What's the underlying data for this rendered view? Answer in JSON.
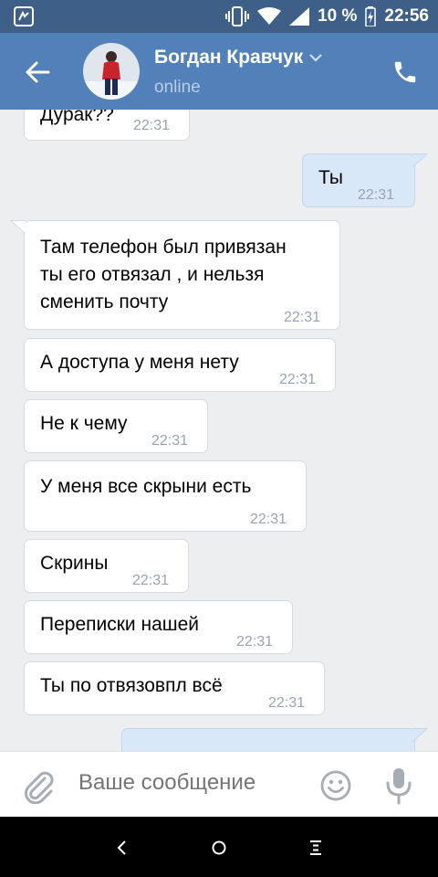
{
  "status_bar": {
    "battery_percent": "10 %",
    "time": "22:56",
    "icons": [
      "app-notification-icon",
      "vibrate-icon",
      "wifi-icon",
      "signal-icon",
      "battery-charging-icon"
    ]
  },
  "header": {
    "name": "Богдан Кравчук",
    "status": "online",
    "icons": [
      "back-arrow-icon",
      "avatar",
      "chevron-down-icon",
      "phone-icon"
    ]
  },
  "messages": [
    {
      "text": "Дурак??",
      "time": "22:31",
      "direction": "in"
    },
    {
      "text": "Ты",
      "time": "22:31",
      "direction": "out"
    },
    {
      "text": "Там телефон был привязан\nты его отвязал , и нельзя\nсменить почту",
      "time": "22:31",
      "direction": "in"
    },
    {
      "text": "А доступа у меня нету",
      "time": "22:31",
      "direction": "in"
    },
    {
      "text": "Не к чему",
      "time": "22:31",
      "direction": "in"
    },
    {
      "text": "У меня все скрыни есть",
      "time": "22:31",
      "direction": "in"
    },
    {
      "text": "Скрины",
      "time": "22:31",
      "direction": "in"
    },
    {
      "text": "Переписки нашей",
      "time": "22:31",
      "direction": "in"
    },
    {
      "text": "Ты по отвязовпл всё",
      "time": "22:31",
      "direction": "in"
    }
  ],
  "composer": {
    "placeholder": "Ваше сообщение",
    "icons": [
      "attach-icon",
      "emoji-icon",
      "microphone-icon"
    ]
  },
  "nav_bar": {
    "icons": [
      "nav-back-icon",
      "nav-home-icon",
      "nav-menu-icon"
    ]
  },
  "colors": {
    "status_bar": "#3e5f87",
    "header": "#5181b8",
    "chat_background": "#edeef0",
    "incoming_bubble": "#ffffff",
    "outgoing_bubble": "#d9e8f8",
    "timestamp": "#9aa3ad"
  }
}
